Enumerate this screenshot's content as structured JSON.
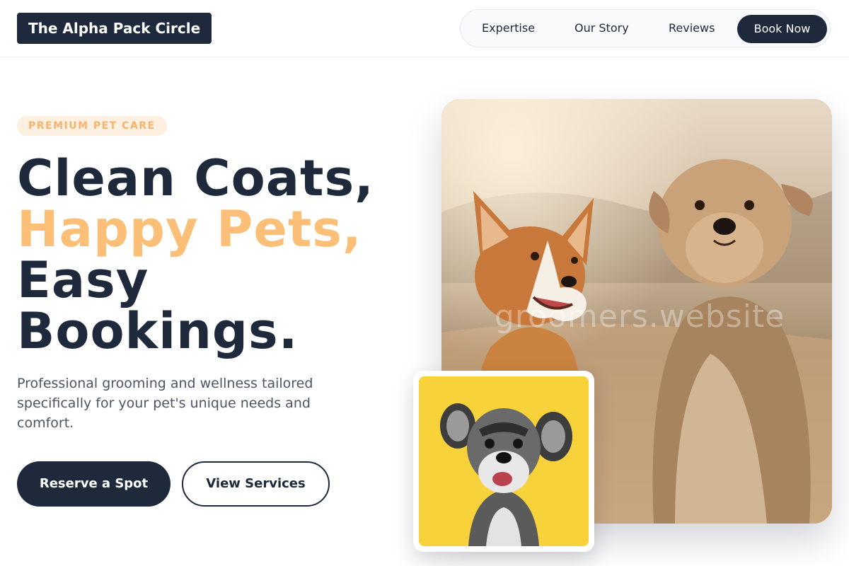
{
  "header": {
    "brand": "The Alpha Pack Circle",
    "nav": {
      "expertise": "Expertise",
      "story": "Our Story",
      "reviews": "Reviews",
      "cta": "Book Now"
    }
  },
  "hero": {
    "badge": "PREMIUM PET CARE",
    "headline": {
      "line1": "Clean Coats,",
      "line2": "Happy Pets,",
      "line3": "Easy",
      "line4": "Bookings."
    },
    "lead": "Professional grooming and wellness tailored specifically for your pet's unique needs and comfort.",
    "primary_button": "Reserve a Spot",
    "secondary_button": "View Services",
    "main_image_watermark": "groomers.website"
  },
  "colors": {
    "navy": "#1e293b",
    "accent": "#fbbf77",
    "badge_bg": "#fdf0e0",
    "inset_bg": "#f7d23a"
  }
}
